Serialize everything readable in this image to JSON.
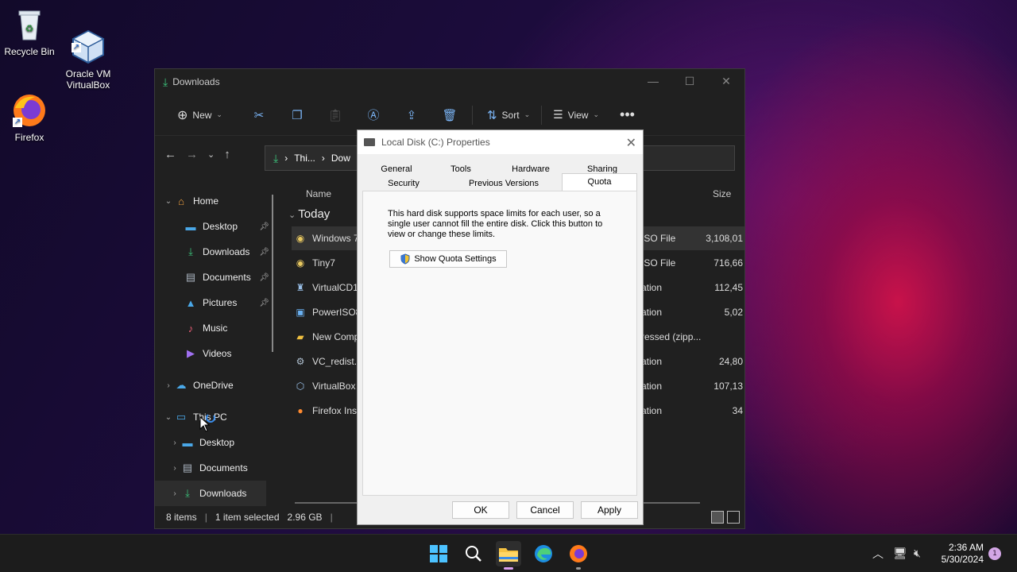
{
  "desktop": {
    "icons": [
      {
        "label": "Recycle Bin"
      },
      {
        "label": "Oracle VM\nVirtualBox"
      },
      {
        "label": "Firefox"
      }
    ]
  },
  "explorer": {
    "title": "Downloads",
    "toolbar": {
      "new_label": "New",
      "sort_label": "Sort",
      "view_label": "View"
    },
    "address": {
      "crumb1": "Thi...",
      "crumb2": "Dow"
    },
    "nav": {
      "home": "Home",
      "desktop": "Desktop",
      "downloads": "Downloads",
      "documents": "Documents",
      "pictures": "Pictures",
      "music": "Music",
      "videos": "Videos",
      "onedrive": "OneDrive",
      "thispc": "This PC",
      "pc_desktop": "Desktop",
      "pc_documents": "Documents",
      "pc_downloads": "Downloads"
    },
    "columns": {
      "name": "Name",
      "size": "Size"
    },
    "group": "Today",
    "files": [
      {
        "name": "Windows 7",
        "type": "ISO File",
        "size": "3,108,01"
      },
      {
        "name": "Tiny7",
        "type": "ISO File",
        "size": "716,66"
      },
      {
        "name": "VirtualCD1",
        "type": "ation",
        "size": "112,45"
      },
      {
        "name": "PowerISO8",
        "type": "ation",
        "size": "5,02"
      },
      {
        "name": "New Comp",
        "type": "ressed (zipp...",
        "size": ""
      },
      {
        "name": "VC_redist.x",
        "type": "ation",
        "size": "24,80"
      },
      {
        "name": "VirtualBox",
        "type": "ation",
        "size": "107,13"
      },
      {
        "name": "Firefox Ins",
        "type": "ation",
        "size": "34"
      }
    ],
    "status": {
      "items": "8 items",
      "selected": "1 item selected",
      "size": "2.96 GB"
    }
  },
  "dialog": {
    "title": "Local Disk (C:) Properties",
    "tabs_row1": [
      "General",
      "Tools",
      "Hardware",
      "Sharing"
    ],
    "tabs_row2": [
      "Security",
      "Previous Versions"
    ],
    "active_tab": "Quota",
    "description": "This hard disk supports space limits for each user, so a single user cannot fill the entire disk. Click this button to view or change these limits.",
    "quota_button": "Show Quota Settings",
    "ok": "OK",
    "cancel": "Cancel",
    "apply": "Apply"
  },
  "taskbar": {
    "time": "2:36 AM",
    "date": "5/30/2024",
    "notification_count": "1"
  }
}
